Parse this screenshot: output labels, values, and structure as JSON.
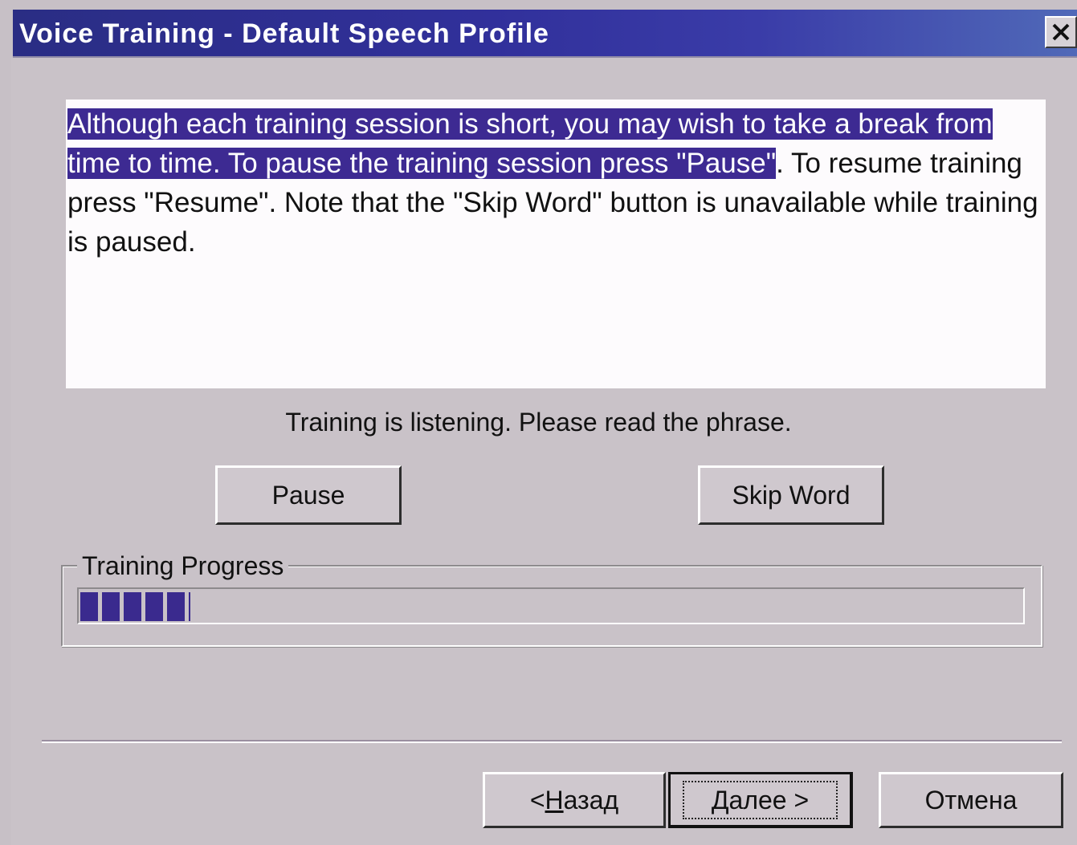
{
  "window": {
    "title": "Voice Training - Default Speech Profile",
    "close_glyph": "✕"
  },
  "instructions": {
    "highlighted": "Although each training session is short, you may wish to take a break from time to time.  To pause the training session press \"Pause\"",
    "rest": ".  To resume training press \"Resume\".  Note that the \"Skip Word\" button is unavailable while training is paused."
  },
  "status": {
    "text": "Training is listening.  Please read the phrase."
  },
  "controls": {
    "pause_label": "Pause",
    "skip_word_label": "Skip Word"
  },
  "progress": {
    "label": "Training Progress",
    "fraction": 0.117,
    "fill_color": "#3a2a8e"
  },
  "nav": {
    "back_prefix": "< ",
    "back_mnemonic": "Н",
    "back_rest": "азад",
    "next_mnemonic": "Д",
    "next_rest": "алее >",
    "cancel_label": "Отмена"
  },
  "colors": {
    "titlebar": "#2a2d84",
    "selection": "#3d2a92",
    "face": "#c9c2c8"
  }
}
